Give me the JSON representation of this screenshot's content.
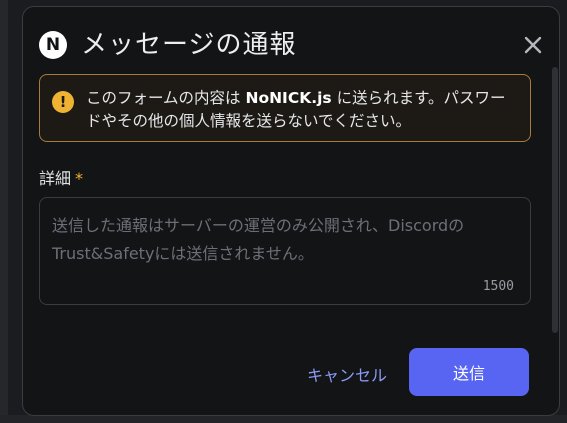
{
  "modal": {
    "app_icon_letter": "N",
    "title": "メッセージの通報",
    "close_icon": "close-icon"
  },
  "notice": {
    "icon": "warning-icon",
    "text_before": "このフォームの内容は ",
    "text_bold": "NoNICK.js",
    "text_after": " に送られます。パスワードやその他の個人情報を送らないでください。"
  },
  "field": {
    "label": "詳細",
    "required_mark": "*",
    "placeholder": "送信した通報はサーバーの運営のみ公開され、DiscordのTrust&Safetyには送信されません。",
    "value": "",
    "char_count": "1500"
  },
  "buttons": {
    "cancel_label": "キャンセル",
    "submit_label": "送信"
  },
  "colors": {
    "accent": "#5865f2",
    "warning": "#f0b232",
    "link": "#8c9af4"
  }
}
